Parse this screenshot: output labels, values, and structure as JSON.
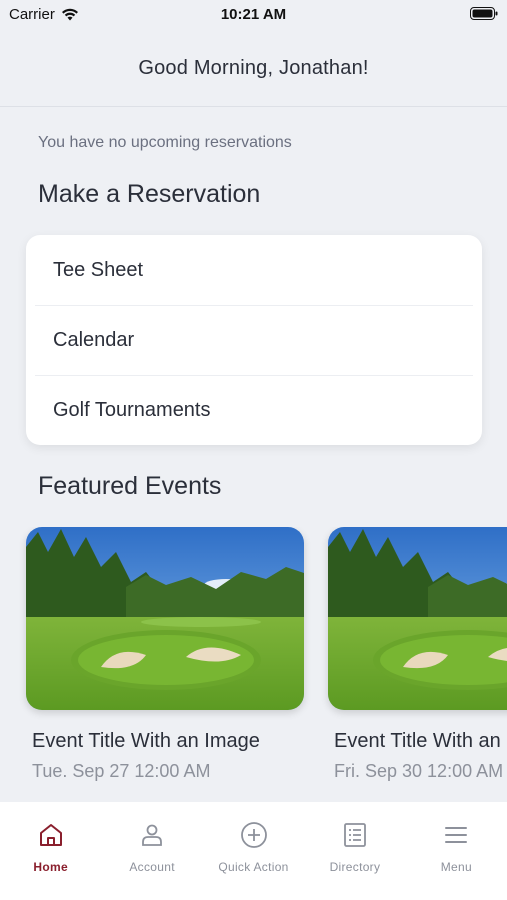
{
  "status_bar": {
    "carrier": "Carrier",
    "time": "10:21 AM"
  },
  "header": {
    "greeting": "Good Morning, Jonathan!"
  },
  "reservations": {
    "empty_message": "You have no upcoming reservations",
    "section_title": "Make a Reservation",
    "items": [
      {
        "label": "Tee Sheet"
      },
      {
        "label": "Calendar"
      },
      {
        "label": "Golf Tournaments"
      }
    ]
  },
  "featured_events": {
    "section_title": "Featured Events",
    "events": [
      {
        "title": "Event Title With an Image",
        "date": "Tue. Sep 27 12:00 AM"
      },
      {
        "title": "Event Title With an Image",
        "date": "Fri. Sep 30 12:00 AM"
      }
    ]
  },
  "tab_bar": {
    "active_color": "#8a1f2d",
    "inactive_color": "#8d919b",
    "tabs": [
      {
        "label": "Home",
        "icon": "home-icon",
        "active": true
      },
      {
        "label": "Account",
        "icon": "person-icon",
        "active": false
      },
      {
        "label": "Quick Action",
        "icon": "plus-circle-icon",
        "active": false
      },
      {
        "label": "Directory",
        "icon": "list-icon",
        "active": false
      },
      {
        "label": "Menu",
        "icon": "hamburger-icon",
        "active": false
      }
    ]
  }
}
